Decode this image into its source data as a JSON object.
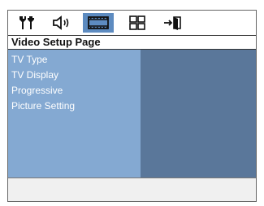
{
  "tabs": [
    {
      "icon": "wrench-settings-icon",
      "active": false
    },
    {
      "icon": "speaker-audio-icon",
      "active": false
    },
    {
      "icon": "film-video-icon",
      "active": true
    },
    {
      "icon": "preferences-grid-icon",
      "active": false
    },
    {
      "icon": "exit-door-icon",
      "active": false
    }
  ],
  "page_title": "Video Setup Page",
  "menu": {
    "items": [
      {
        "label": "TV Type"
      },
      {
        "label": "TV Display"
      },
      {
        "label": "Progressive"
      },
      {
        "label": "Picture Setting"
      }
    ]
  },
  "colors": {
    "active_tab": "#5d8bc0",
    "menu_left": "#84a9d2",
    "menu_right": "#5a779a"
  }
}
